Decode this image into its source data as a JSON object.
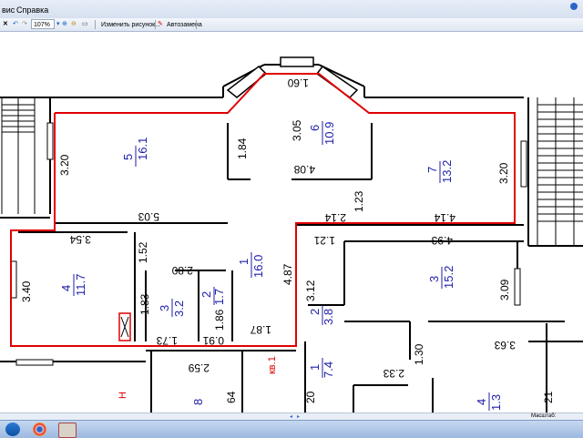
{
  "menu": {
    "items": [
      "вис",
      "Справка"
    ]
  },
  "toolbar": {
    "zoom": "107%",
    "edit_picture": "Изменить рисунок...",
    "autofit": "Автозамена"
  },
  "status": {
    "scale_label": "Масштаб:"
  },
  "colors": {
    "walls": "#000000",
    "unit_outline": "#e00000",
    "room_labels": "#1c1ca8",
    "dimensions": "#000000"
  },
  "plan": {
    "rooms": [
      {
        "id": "5",
        "area": "16.1"
      },
      {
        "id": "6",
        "area": "10.9"
      },
      {
        "id": "7",
        "area": "13.2"
      },
      {
        "id": "4",
        "area": "11.7"
      },
      {
        "id": "1",
        "area": "16.0"
      },
      {
        "id": "3",
        "area": "3.2"
      },
      {
        "id": "2",
        "area": "1.7"
      },
      {
        "id": "3",
        "area": "15.2"
      },
      {
        "id": "2",
        "area": "3.8"
      },
      {
        "id": "1",
        "area": "7.4"
      },
      {
        "id": "8",
        "area": ""
      },
      {
        "id": "4",
        "area": "1.3"
      }
    ],
    "dimensions": [
      "1.60",
      "3.05",
      "1.84",
      "4.08",
      "3.20",
      "5.03",
      "3.20",
      "1.23",
      "2.14",
      "4.14",
      "3.54",
      "1.52",
      "2.80",
      "3.40",
      "1.83",
      "1.86",
      "1.73",
      "0.91",
      "1.87",
      "4.87",
      "1.21",
      "4.93",
      "3.12",
      "3.09",
      "3.63",
      "1.30",
      "2.33",
      "2.59",
      "64",
      "20",
      "21"
    ],
    "red_labels": [
      "кв.1",
      "Н"
    ]
  }
}
